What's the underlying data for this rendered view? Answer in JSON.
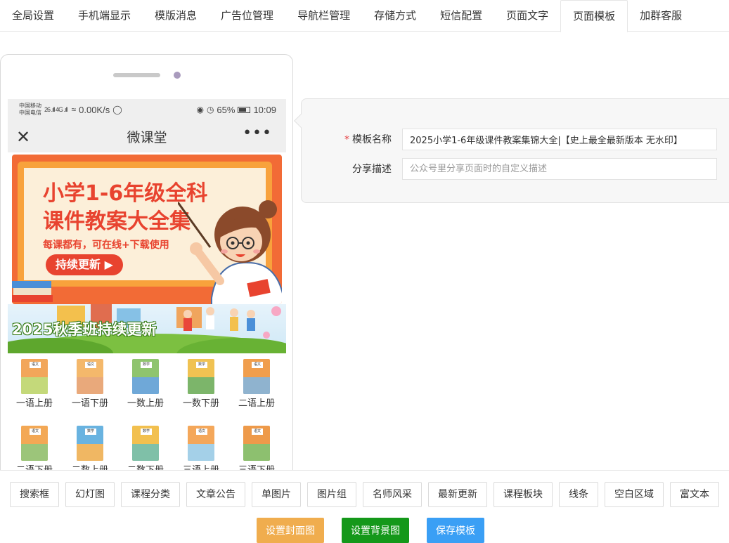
{
  "tabs": [
    {
      "label": "全局设置",
      "active": false
    },
    {
      "label": "手机端显示",
      "active": false
    },
    {
      "label": "模版消息",
      "active": false
    },
    {
      "label": "广告位管理",
      "active": false
    },
    {
      "label": "导航栏管理",
      "active": false
    },
    {
      "label": "存储方式",
      "active": false
    },
    {
      "label": "短信配置",
      "active": false
    },
    {
      "label": "页面文字",
      "active": false
    },
    {
      "label": "页面模板",
      "active": true
    },
    {
      "label": "加群客服",
      "active": false
    }
  ],
  "phone": {
    "status": {
      "carrier_1": "中国移动",
      "carrier_2": "中国电信",
      "signal": "26 .ıll 4G .ıll",
      "speed": "0.00K/s",
      "battery_pct": "65%",
      "time": "10:09"
    },
    "title": "微课堂",
    "banner": {
      "line1": "小学1-6年级全科",
      "line2": "课件教案大全集",
      "subtitle": "每课都有，可在线+下载使用",
      "button": "持续更新 ▶"
    },
    "autumn_text": "2025秋季班持续更新",
    "books": [
      {
        "label": "一语上册",
        "tag": "语文",
        "color": "#f2a65a",
        "scene": "#c4d97a"
      },
      {
        "label": "一语下册",
        "tag": "语文",
        "color": "#f4b86b",
        "scene": "#e9a97b"
      },
      {
        "label": "一数上册",
        "tag": "数学",
        "color": "#8fc46e",
        "scene": "#6fa8d8"
      },
      {
        "label": "一数下册",
        "tag": "数学",
        "color": "#f0c252",
        "scene": "#7cb56a"
      },
      {
        "label": "二语上册",
        "tag": "语文",
        "color": "#f09e4d",
        "scene": "#8fb3cf"
      },
      {
        "label": "二语下册",
        "tag": "语文",
        "color": "#f3a855",
        "scene": "#9cc57a"
      },
      {
        "label": "二数上册",
        "tag": "数学",
        "color": "#69b3e0",
        "scene": "#f0b763"
      },
      {
        "label": "二数下册",
        "tag": "数学",
        "color": "#f2c04f",
        "scene": "#7fc0a8"
      },
      {
        "label": "三语上册",
        "tag": "语文",
        "color": "#f4a75a",
        "scene": "#a4d0e8"
      },
      {
        "label": "三语下册",
        "tag": "语文",
        "color": "#ee9a4a",
        "scene": "#8dc06f"
      }
    ]
  },
  "form": {
    "name_label": "模板名称",
    "name_required": "*",
    "name_value": "2025小学1-6年级课件教案集锦大全|【史上最全最新版本 无水印】",
    "desc_label": "分享描述",
    "desc_placeholder": "公众号里分享页面时的自定义描述"
  },
  "tools": [
    "搜索框",
    "幻灯图",
    "课程分类",
    "文章公告",
    "单图片",
    "图片组",
    "名师风采",
    "最新更新",
    "课程板块",
    "线条",
    "空白区域",
    "富文本"
  ],
  "actions": [
    {
      "label": "设置封面图",
      "color": "#f0ad4e"
    },
    {
      "label": "设置背景图",
      "color": "#14981a"
    },
    {
      "label": "保存模板",
      "color": "#3a9ff5"
    }
  ]
}
